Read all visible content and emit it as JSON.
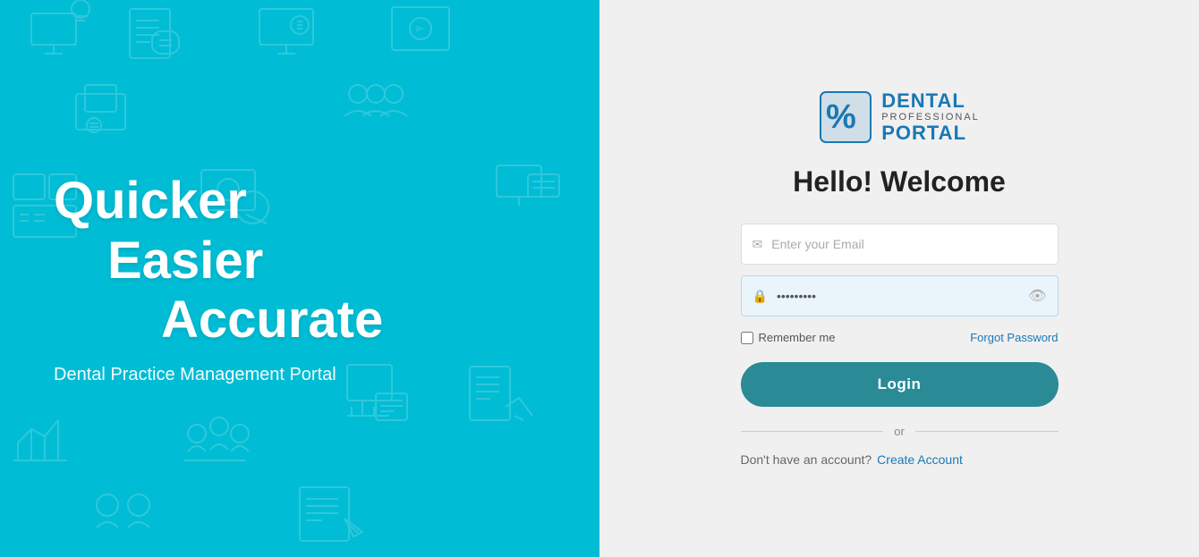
{
  "left": {
    "headline_line1": "Quicker",
    "headline_line2": "Easier",
    "headline_line3": "Accurate",
    "subheading": "Dental Practice Management Portal",
    "bg_color": "#00BCD4"
  },
  "logo": {
    "dental": "DENTAL",
    "professional": "PROFESSIONAL",
    "portal": "PORTAL"
  },
  "form": {
    "welcome": "Hello! Welcome",
    "email_placeholder": "Enter your Email",
    "password_value": "·········",
    "remember_label": "Remember me",
    "forgot_label": "Forgot Password",
    "login_label": "Login",
    "divider_text": "or",
    "no_account_text": "Don't have an account?",
    "create_account_label": "Create Account"
  }
}
